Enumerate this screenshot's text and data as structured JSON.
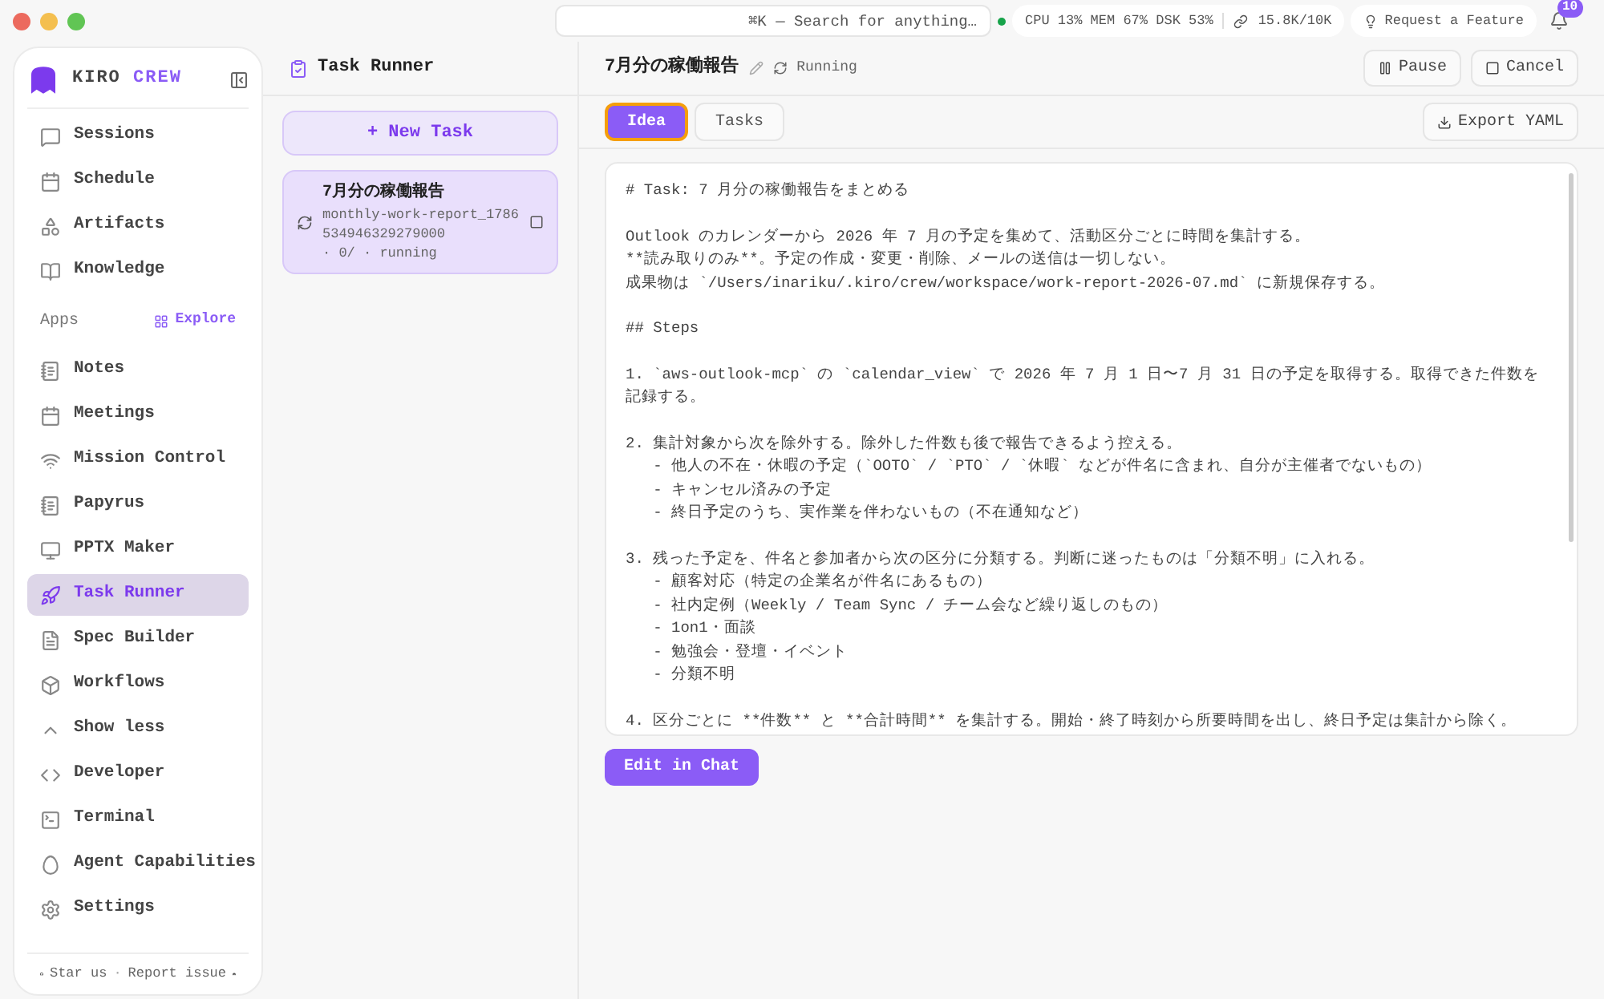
{
  "topbar": {
    "search": {
      "placeholder": "⌘K — Search for anything…"
    },
    "stats": "CPU 13% MEM 67% DSK 53%",
    "tokens": "15.8K/10K",
    "request": "Request a Feature",
    "notifications": "10"
  },
  "sidebar": {
    "brand": [
      "KIRO",
      "CREW"
    ],
    "items": [
      {
        "label": "Sessions",
        "selected": false
      },
      {
        "label": "Schedule",
        "selected": false
      },
      {
        "label": "Artifacts",
        "selected": false
      },
      {
        "label": "Knowledge",
        "selected": false
      }
    ],
    "apps_title": "Apps",
    "explore": "Explore",
    "apps": [
      {
        "label": "Notes",
        "selected": false
      },
      {
        "label": "Meetings",
        "selected": false
      },
      {
        "label": "Mission Control",
        "selected": false
      },
      {
        "label": "Papyrus",
        "selected": false
      },
      {
        "label": "PPTX Maker",
        "selected": false
      },
      {
        "label": "Task Runner",
        "selected": true
      },
      {
        "label": "Spec Builder",
        "selected": false
      },
      {
        "label": "Workflows",
        "selected": false
      },
      {
        "label": "Show less",
        "selected": false
      },
      {
        "label": "Developer",
        "selected": false
      },
      {
        "label": "Terminal",
        "selected": false
      },
      {
        "label": "Agent Capabilities",
        "selected": false
      },
      {
        "label": "Settings",
        "selected": false
      }
    ],
    "footer": {
      "star": "Star us",
      "separator": "·",
      "report": "Report issue"
    }
  },
  "tasks_panel": {
    "title": "Task Runner",
    "new_task": "+ New Task",
    "tasks": [
      {
        "title": "7月分の稼働報告",
        "id": "monthly-work-report_1786534946329279000",
        "meta": "· 0/ · running",
        "selected": true
      }
    ]
  },
  "detail": {
    "title": "7月分の稼働報告",
    "status": "Running",
    "pause": "Pause",
    "cancel": "Cancel",
    "tabs": [
      {
        "label": "Idea",
        "selected": true
      },
      {
        "label": "Tasks",
        "selected": false
      }
    ],
    "export": "Export YAML",
    "paragraphs": [
      [
        "# Task: 7 月分の稼働報告をまとめる"
      ],
      [
        "Outlook のカレンダーから 2026 年 7 月の予定を集めて、活動区分ごとに時間を集計する。",
        "**読み取りのみ**。予定の作成・変更・削除、メールの送信は一切しない。",
        "成果物は `/Users/inariku/.kiro/crew/workspace/work-report-2026-07.md` に新規保存する。"
      ],
      [
        "## Steps"
      ],
      [
        "1. `aws-outlook-mcp` の `calendar_view` で 2026 年 7 月 1 日〜7 月 31 日の予定を取得する。取得できた件数を記録する。"
      ],
      [
        "2. 集計対象から次を除外する。除外した件数も後で報告できるよう控える。",
        "   - 他人の不在・休暇の予定（`OOTO` / `PTO` / `休暇` などが件名に含まれ、自分が主催者でないもの）",
        "   - キャンセル済みの予定",
        "   - 終日予定のうち、実作業を伴わないもの（不在通知など）"
      ],
      [
        "3. 残った予定を、件名と参加者から次の区分に分類する。判断に迷ったものは「分類不明」に入れる。",
        "   - 顧客対応（特定の企業名が件名にあるもの）",
        "   - 社内定例（Weekly / Team Sync / チーム会など繰り返しのもの）",
        "   - 1on1・面談",
        "   - 勉強会・登壇・イベント",
        "   - 分類不明"
      ],
      [
        "4. 区分ごとに **件数** と **合計時間** を集計する。開始・終了時刻から所要時間を出し、終日予定は集計から除く。"
      ]
    ],
    "edit_chat": "Edit in Chat"
  }
}
